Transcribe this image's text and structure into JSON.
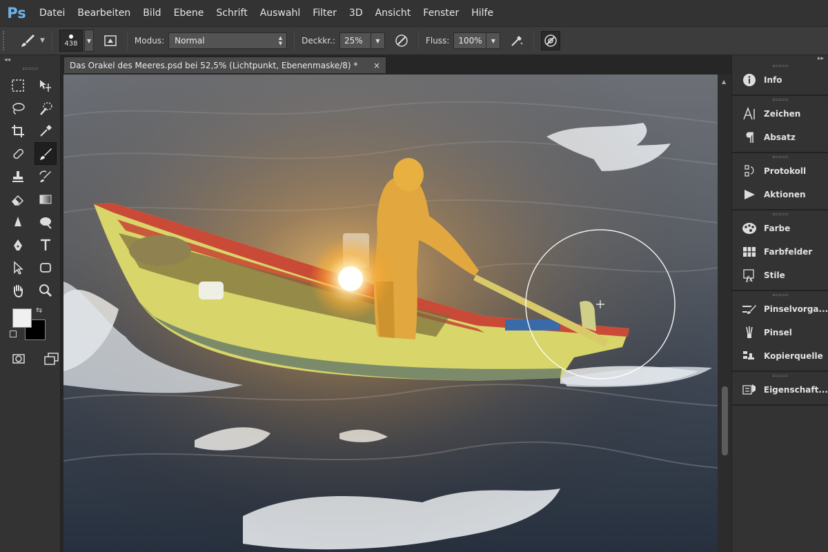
{
  "app": {
    "logo": "Ps"
  },
  "menu": [
    "Datei",
    "Bearbeiten",
    "Bild",
    "Ebene",
    "Schrift",
    "Auswahl",
    "Filter",
    "3D",
    "Ansicht",
    "Fenster",
    "Hilfe"
  ],
  "options": {
    "brush_size": "438",
    "mode_label": "Modus:",
    "mode_value": "Normal",
    "opacity_label": "Deckkr.:",
    "opacity_value": "25%",
    "flow_label": "Fluss:",
    "flow_value": "100%"
  },
  "toolbar": {
    "collapse": "◂◂"
  },
  "document": {
    "tab_title": "Das Orakel des Meeres.psd bei 52,5% (Lichtpunkt, Ebenenmaske/8) *",
    "close": "×"
  },
  "dock": {
    "collapse": "▸▸",
    "groups": [
      [
        {
          "label": "Info",
          "icon": "info-icon"
        }
      ],
      [
        {
          "label": "Zeichen",
          "icon": "character-icon"
        },
        {
          "label": "Absatz",
          "icon": "paragraph-icon"
        }
      ],
      [
        {
          "label": "Protokoll",
          "icon": "history-icon"
        },
        {
          "label": "Aktionen",
          "icon": "actions-icon"
        }
      ],
      [
        {
          "label": "Farbe",
          "icon": "color-icon"
        },
        {
          "label": "Farbfelder",
          "icon": "swatches-icon"
        },
        {
          "label": "Stile",
          "icon": "styles-icon"
        }
      ],
      [
        {
          "label": "Pinselvorga...",
          "icon": "brush-presets-icon"
        },
        {
          "label": "Pinsel",
          "icon": "brush-icon"
        },
        {
          "label": "Kopierquelle",
          "icon": "clone-source-icon"
        }
      ],
      [
        {
          "label": "Eigenschaft...",
          "icon": "properties-icon"
        }
      ]
    ]
  },
  "colors": {
    "foreground": "#f0f0f0",
    "background": "#000000",
    "accent": "#6fb3e8"
  }
}
